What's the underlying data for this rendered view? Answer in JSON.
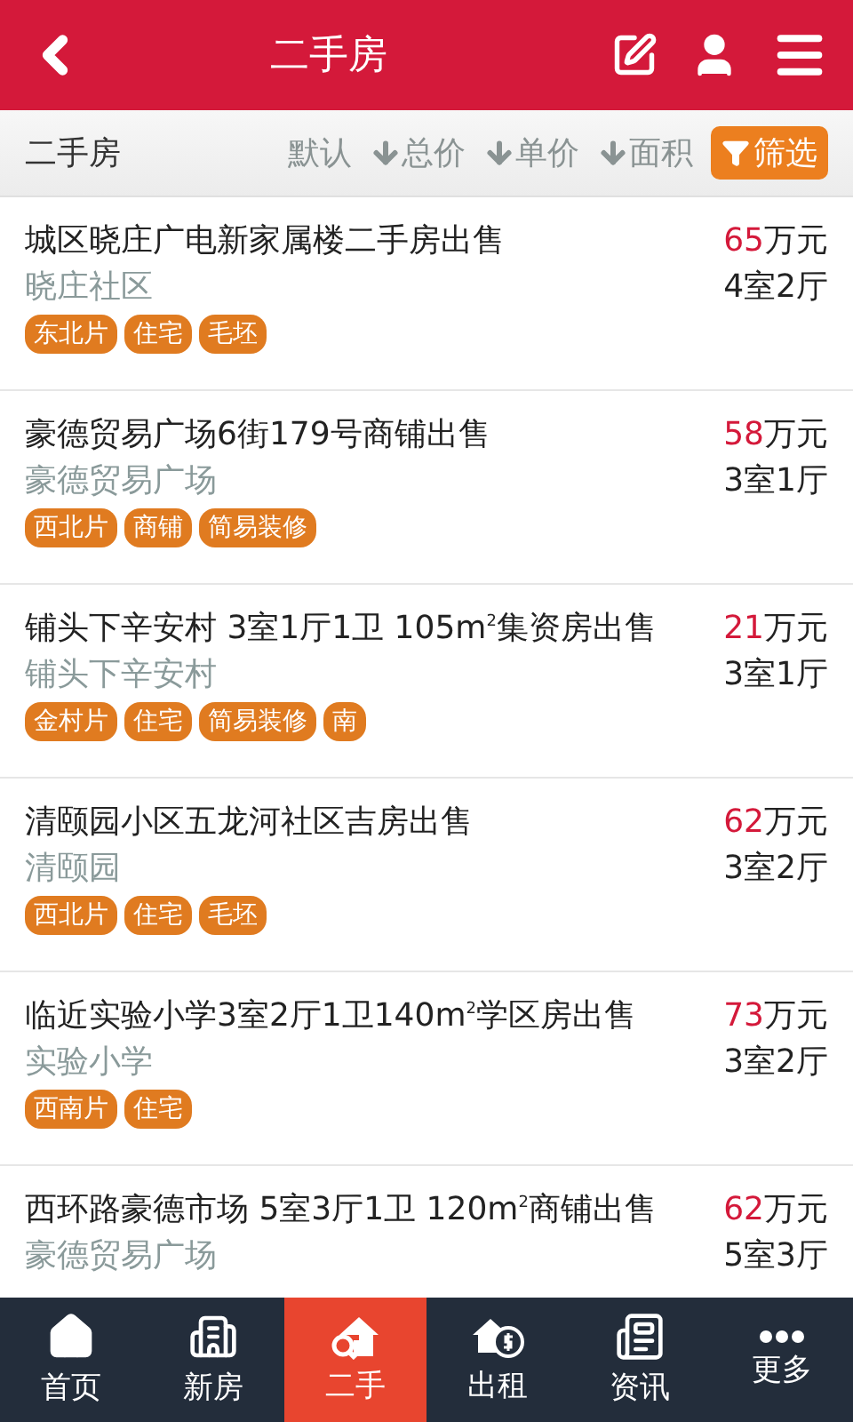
{
  "header": {
    "title": "二手房"
  },
  "filter_bar": {
    "label": "二手房",
    "sorts": [
      {
        "label": "默认",
        "kind": "plain"
      },
      {
        "label": "总价",
        "kind": "sort"
      },
      {
        "label": "单价",
        "kind": "sort"
      },
      {
        "label": "面积",
        "kind": "sort"
      }
    ],
    "filter_button": "筛选"
  },
  "listings": [
    {
      "title": "城区晓庄广电新家属楼二手房出售",
      "community": "晓庄社区",
      "amount": "65",
      "unit": "万元",
      "rooms": "4室2厅",
      "tags": [
        "东北片",
        "住宅",
        "毛坯"
      ]
    },
    {
      "title": "豪德贸易广场6街179号商铺出售",
      "community": "豪德贸易广场",
      "amount": "58",
      "unit": "万元",
      "rooms": "3室1厅",
      "tags": [
        "西北片",
        "商铺",
        "简易装修"
      ]
    },
    {
      "title": "铺头下辛安村 3室1厅1卫 105m$^{2}$集资房出售",
      "community": "铺头下辛安村",
      "amount": "21",
      "unit": "万元",
      "rooms": "3室1厅",
      "tags": [
        "金村片",
        "住宅",
        "简易装修",
        "南"
      ]
    },
    {
      "title": "清颐园小区五龙河社区吉房出售",
      "community": "清颐园",
      "amount": "62",
      "unit": "万元",
      "rooms": "3室2厅",
      "tags": [
        "西北片",
        "住宅",
        "毛坯"
      ]
    },
    {
      "title": "临近实验小学3室2厅1卫140m$^{2}$学区房出售",
      "community": "实验小学",
      "amount": "73",
      "unit": "万元",
      "rooms": "3室2厅",
      "tags": [
        "西南片",
        "住宅"
      ]
    },
    {
      "title": "西环路豪德市场 5室3厅1卫 120m$^{2}$商铺出售",
      "community": "豪德贸易广场",
      "amount": "62",
      "unit": "万元",
      "rooms": "5室3厅"
    }
  ],
  "nav": [
    {
      "label": "首页",
      "selected": false
    },
    {
      "label": "新房",
      "selected": false
    },
    {
      "label": "二手",
      "selected": true
    },
    {
      "label": "出租",
      "selected": false
    },
    {
      "label": "资讯",
      "selected": false
    },
    {
      "label": "更多",
      "selected": false
    }
  ]
}
